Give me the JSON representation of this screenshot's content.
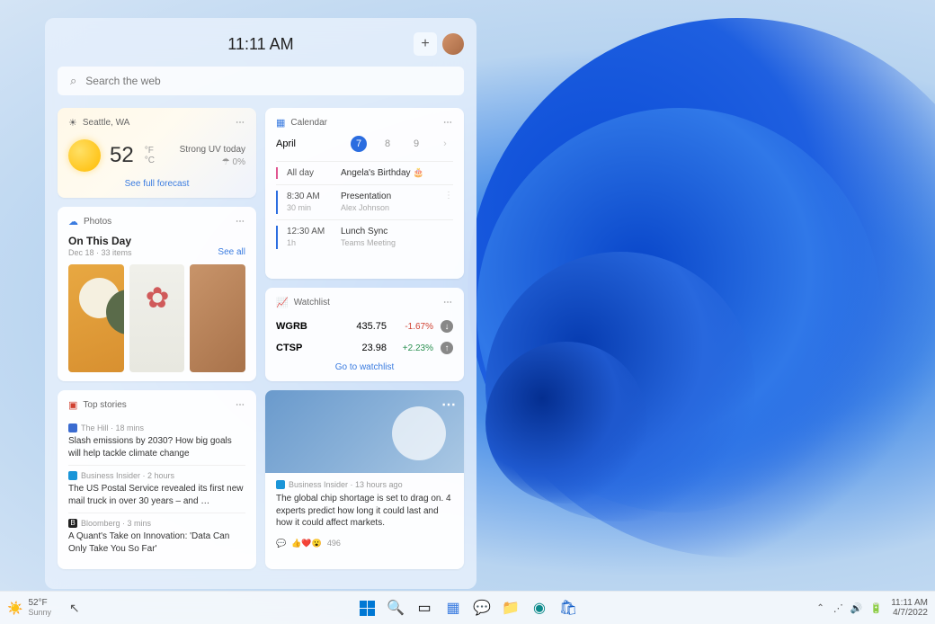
{
  "widgets": {
    "time": "11:11 AM",
    "search_placeholder": "Search the web",
    "weather": {
      "location": "Seattle, WA",
      "temp": "52",
      "unit_f": "°F",
      "unit_c": "°C",
      "condition": "Strong UV today",
      "rain": "0%",
      "footer": "See full forecast"
    },
    "calendar": {
      "title": "Calendar",
      "month": "April",
      "days": [
        "7",
        "8",
        "9"
      ],
      "selected_day_index": 0,
      "events": [
        {
          "time": "All day",
          "duration": "",
          "title": "Angela's Birthday 🎂",
          "sub": "",
          "bar": "pink"
        },
        {
          "time": "8:30 AM",
          "duration": "30 min",
          "title": "Presentation",
          "sub": "Alex Johnson",
          "bar": "blue"
        },
        {
          "time": "12:30 AM",
          "duration": "1h",
          "title": "Lunch Sync",
          "sub": "Teams Meeting",
          "bar": "blue"
        }
      ]
    },
    "photos": {
      "header": "Photos",
      "title": "On This Day",
      "sub": "Dec 18 · 33 items",
      "seeall": "See all"
    },
    "watchlist": {
      "title": "Watchlist",
      "rows": [
        {
          "sym": "WGRB",
          "price": "435.75",
          "chg": "-1.67%",
          "dir": "down"
        },
        {
          "sym": "CTSP",
          "price": "23.98",
          "chg": "+2.23%",
          "dir": "up"
        }
      ],
      "footer": "Go to watchlist"
    },
    "stories": {
      "header": "Top stories",
      "items": [
        {
          "src": "The Hill · 18 mins",
          "color": "#3a6bd0",
          "title": "Slash emissions by 2030? How big goals will help tackle climate change"
        },
        {
          "src": "Business Insider · 2 hours",
          "color": "#1a95d8",
          "title": "The US Postal Service revealed its first new mail truck in over 30 years – and …"
        },
        {
          "src": "Bloomberg · 3 mins",
          "color": "#222",
          "title": "A Quant's Take on Innovation: 'Data Can Only Take You So Far'"
        }
      ]
    },
    "news": {
      "src": "Business Insider · 13 hours ago",
      "title": "The global chip shortage is set to drag on. 4 experts predict how long it could last and how it could affect markets.",
      "reactions": "496"
    }
  },
  "taskbar": {
    "weather_temp": "52°F",
    "weather_cond": "Sunny",
    "clock_time": "11:11 AM",
    "clock_date": "4/7/2022"
  }
}
